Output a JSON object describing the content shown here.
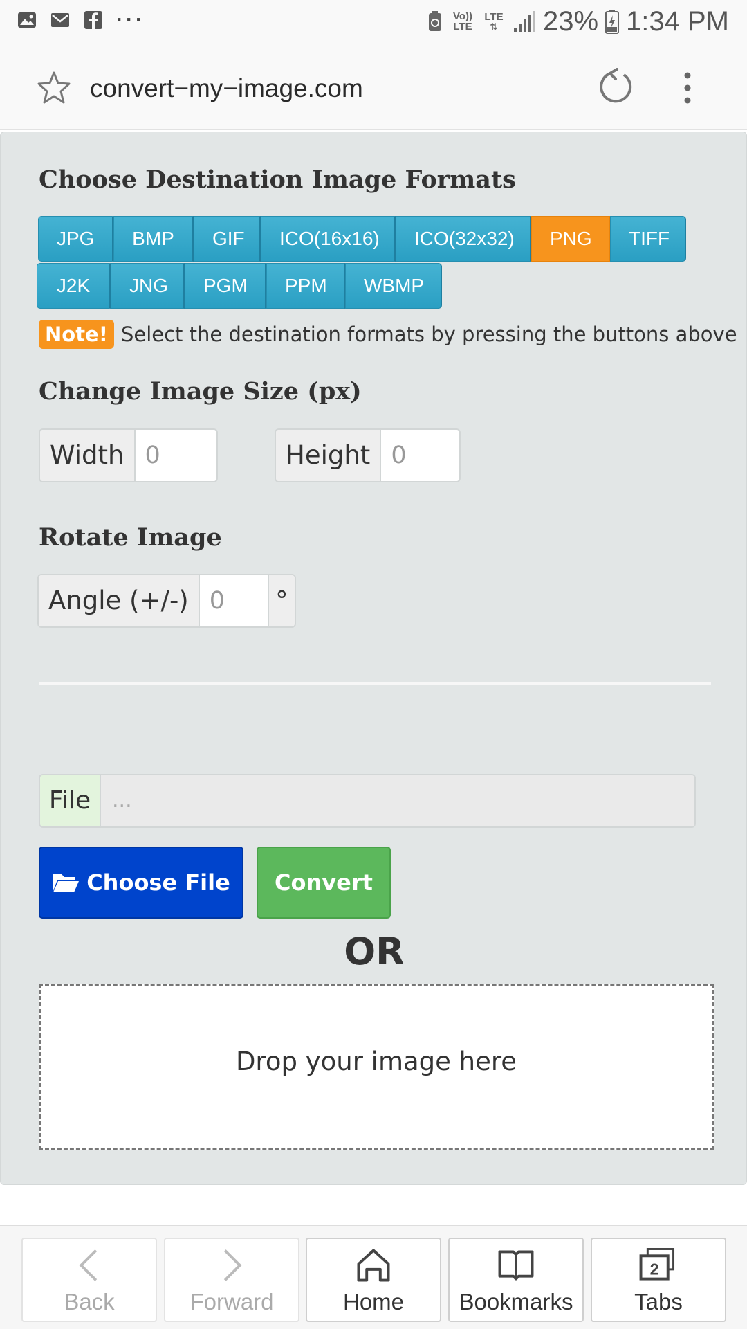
{
  "status_bar": {
    "left_icons": [
      "gallery-icon",
      "email-icon",
      "facebook-icon",
      "more-notifications-icon"
    ],
    "more_dots": "···",
    "volte_label": "Vo)) LTE",
    "lte_label": "LTE",
    "battery_percent": "23%",
    "time": "1:34 PM"
  },
  "address_bar": {
    "url": "convert−my−image.com"
  },
  "formats": {
    "heading": "Choose Destination Image Formats",
    "row1": [
      "JPG",
      "BMP",
      "GIF",
      "ICO(16x16)",
      "ICO(32x32)",
      "PNG",
      "TIFF"
    ],
    "row2": [
      "J2K",
      "JNG",
      "PGM",
      "PPM",
      "WBMP"
    ],
    "selected": "PNG",
    "accent_color": "#f7941d",
    "button_color": "#2ea3c7",
    "note_badge": "Note!",
    "note_text": "Select the destination formats by pressing the buttons above"
  },
  "size": {
    "heading": "Change Image Size (px)",
    "width_label": "Width",
    "width_value": "0",
    "height_label": "Height",
    "height_value": "0"
  },
  "rotate": {
    "heading": "Rotate Image",
    "angle_label": "Angle (+/-)",
    "angle_value": "0",
    "degree_symbol": "°"
  },
  "upload": {
    "file_label": "File",
    "file_placeholder": "...",
    "choose_file_label": "Choose File",
    "convert_label": "Convert",
    "or_text": "OR",
    "drop_text": "Drop your image here",
    "choose_color": "#0044cc",
    "convert_color": "#5cb85c"
  },
  "bottom_nav": {
    "back": "Back",
    "forward": "Forward",
    "home": "Home",
    "bookmarks": "Bookmarks",
    "tabs": "Tabs",
    "tabs_count": "2"
  }
}
